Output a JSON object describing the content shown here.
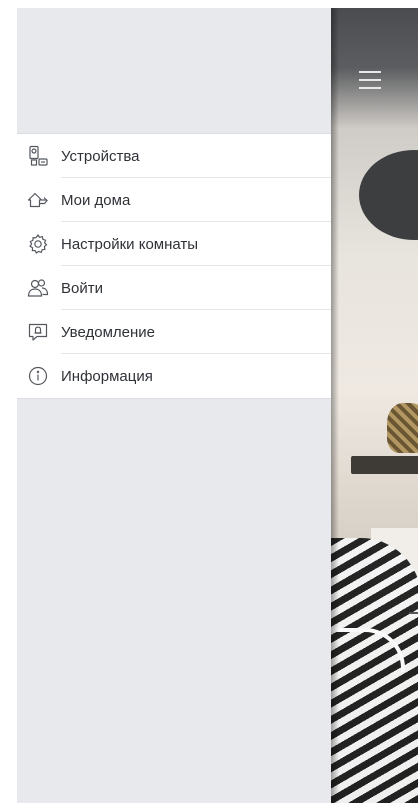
{
  "drawer": {
    "items": [
      {
        "label": "Устройства",
        "icon": "devices-icon"
      },
      {
        "label": "Мои дома",
        "icon": "home-icon"
      },
      {
        "label": "Настройки комнаты",
        "icon": "gear-icon"
      },
      {
        "label": "Войти",
        "icon": "users-icon"
      },
      {
        "label": "Уведомление",
        "icon": "notification-icon"
      },
      {
        "label": "Информация",
        "icon": "info-icon"
      }
    ]
  },
  "colors": {
    "drawer_background": "#e7e9ec",
    "menu_background": "#ffffff",
    "text": "#2f3237",
    "icon": "#55595f"
  }
}
